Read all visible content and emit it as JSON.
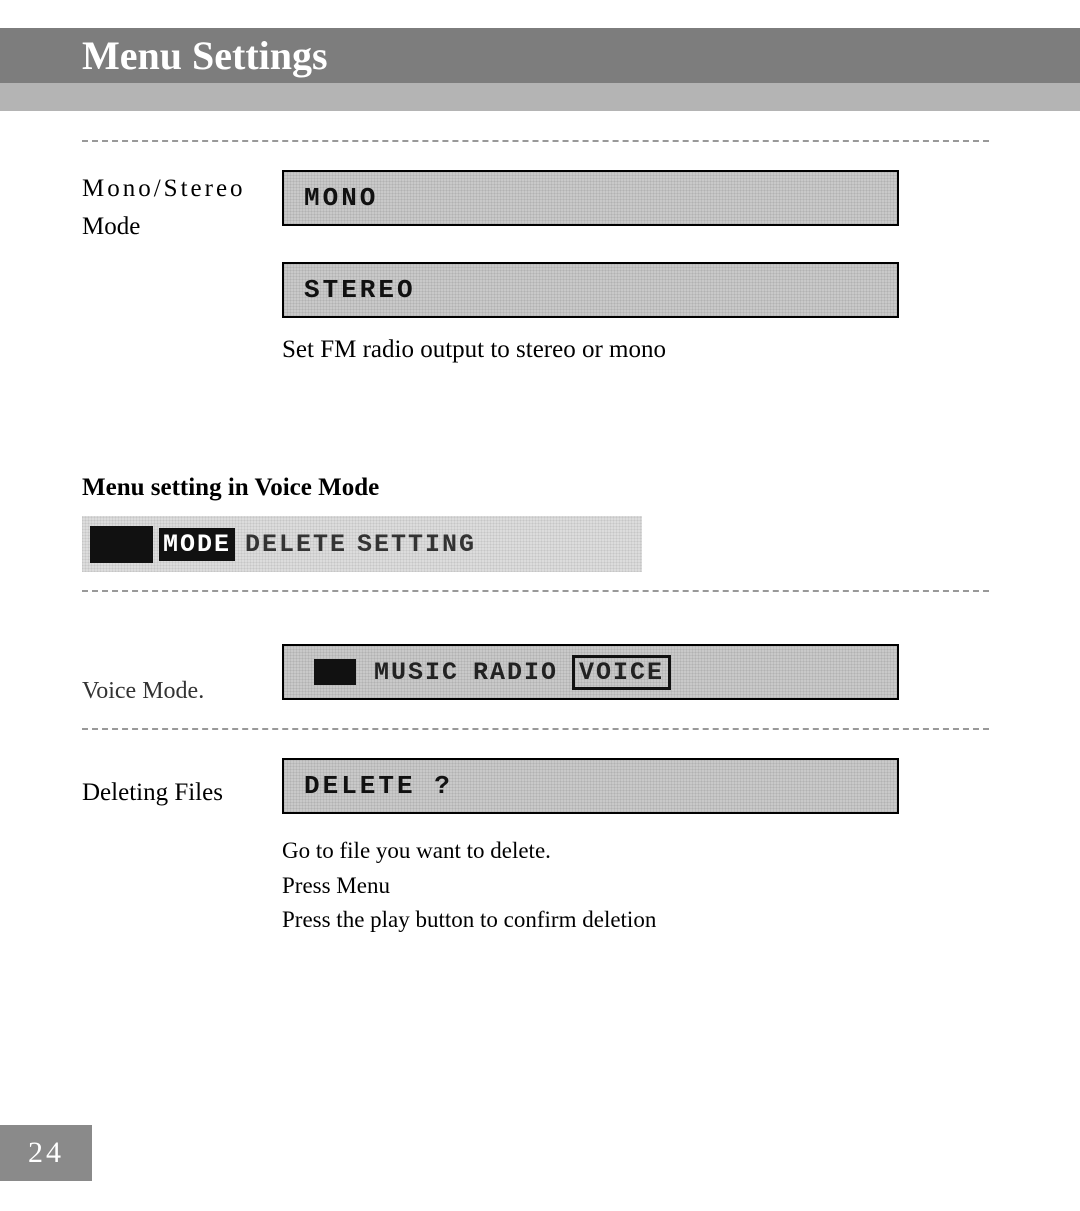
{
  "header": {
    "title": "Menu Settings"
  },
  "mono_stereo": {
    "label_line1": "Mono/Stereo",
    "label_line2": "Mode",
    "option1": "MONO",
    "option2": "STEREO",
    "description": "Set FM radio output to stereo or mono"
  },
  "voice_menu": {
    "heading": "Menu setting in Voice Mode",
    "menu_items": {
      "prefix_icon": "menu-icon",
      "highlighted": "MODE",
      "item2": "DELETE",
      "item3": "SETTING"
    }
  },
  "mode_row": {
    "partial_label": "Voice Mode.",
    "icon": "mode-icon",
    "item1": "MUSIC",
    "item2": "RADIO",
    "highlighted": "VOICE"
  },
  "delete_section": {
    "label": "Deleting  Files",
    "lcd": "DELETE ?",
    "step1": "Go to file you want to delete.",
    "step2": "Press Menu",
    "step3": "Press the play button to confirm deletion"
  },
  "page_number": "24"
}
